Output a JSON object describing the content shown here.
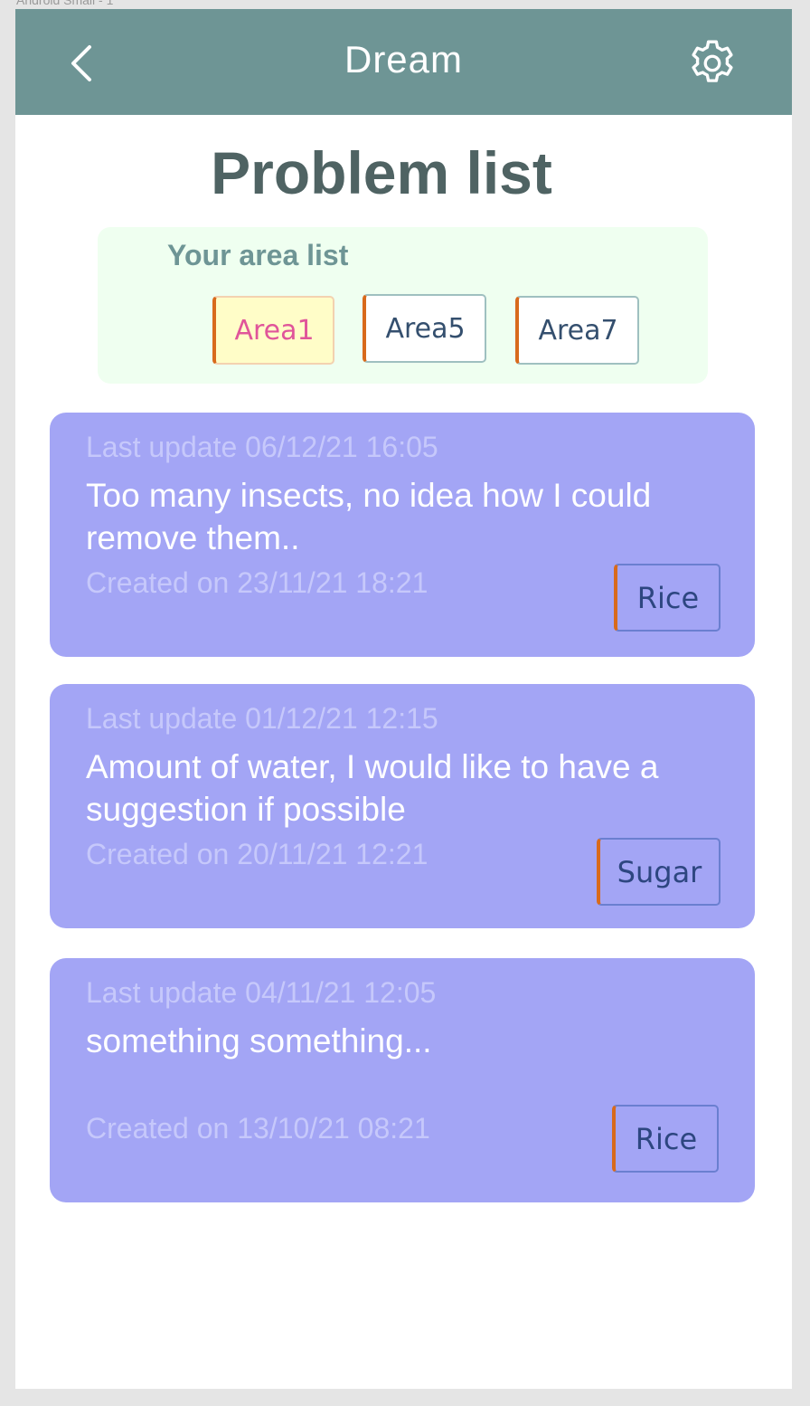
{
  "frame_label": "Android Small - 1",
  "header": {
    "title": "Dream",
    "back_icon": "chevron-left-icon",
    "settings_icon": "gear-icon",
    "background_color": "#6e9595"
  },
  "page_title": "Problem list",
  "area_list": {
    "heading": "Your area list",
    "areas": [
      {
        "label": "Area1",
        "selected": true
      },
      {
        "label": "Area5",
        "selected": false
      },
      {
        "label": "Area7",
        "selected": false
      }
    ]
  },
  "problems": [
    {
      "last_update": "Last update 06/12/21 16:05",
      "description": "Too many insects, no idea how I could remove them..",
      "created": "Created on 23/11/21 18:21",
      "tag": "Rice"
    },
    {
      "last_update": "Last update 01/12/21 12:15",
      "description": "Amount of water, I would like to have a suggestion if possible",
      "created": "Created on 20/11/21 12:21",
      "tag": "Sugar"
    },
    {
      "last_update": "Last update 04/11/21 12:05",
      "description": "something something...",
      "created": "Created on 13/10/21 08:21",
      "tag": "Rice"
    }
  ],
  "colors": {
    "card": "#a3a5f5",
    "accent_orange": "#d86a1c",
    "area_panel": "#effff0"
  }
}
